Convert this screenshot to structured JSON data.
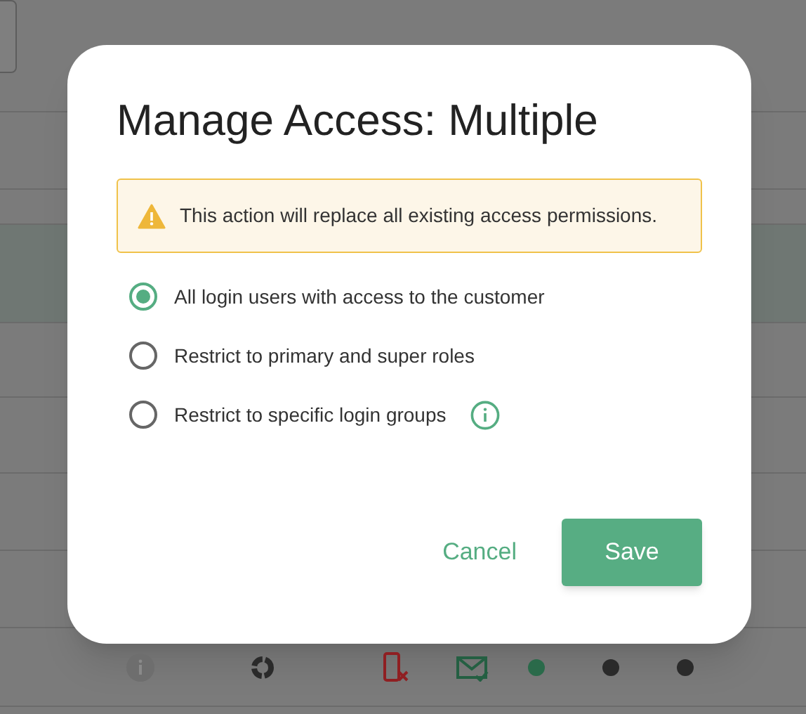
{
  "dialog": {
    "title": "Manage Access: Multiple",
    "warning": "This action will replace all existing access permissions.",
    "options": [
      {
        "label": "All login users with access to the customer",
        "selected": true,
        "info": false
      },
      {
        "label": "Restrict to primary and super roles",
        "selected": false,
        "info": false
      },
      {
        "label": "Restrict to specific login groups",
        "selected": false,
        "info": true
      }
    ],
    "cancel": "Cancel",
    "save": "Save"
  },
  "background_row": {
    "status_dots": [
      {
        "color": "#2a6a4a"
      },
      {
        "color": "#2a2a2a"
      },
      {
        "color": "#2a2a2a"
      }
    ]
  }
}
